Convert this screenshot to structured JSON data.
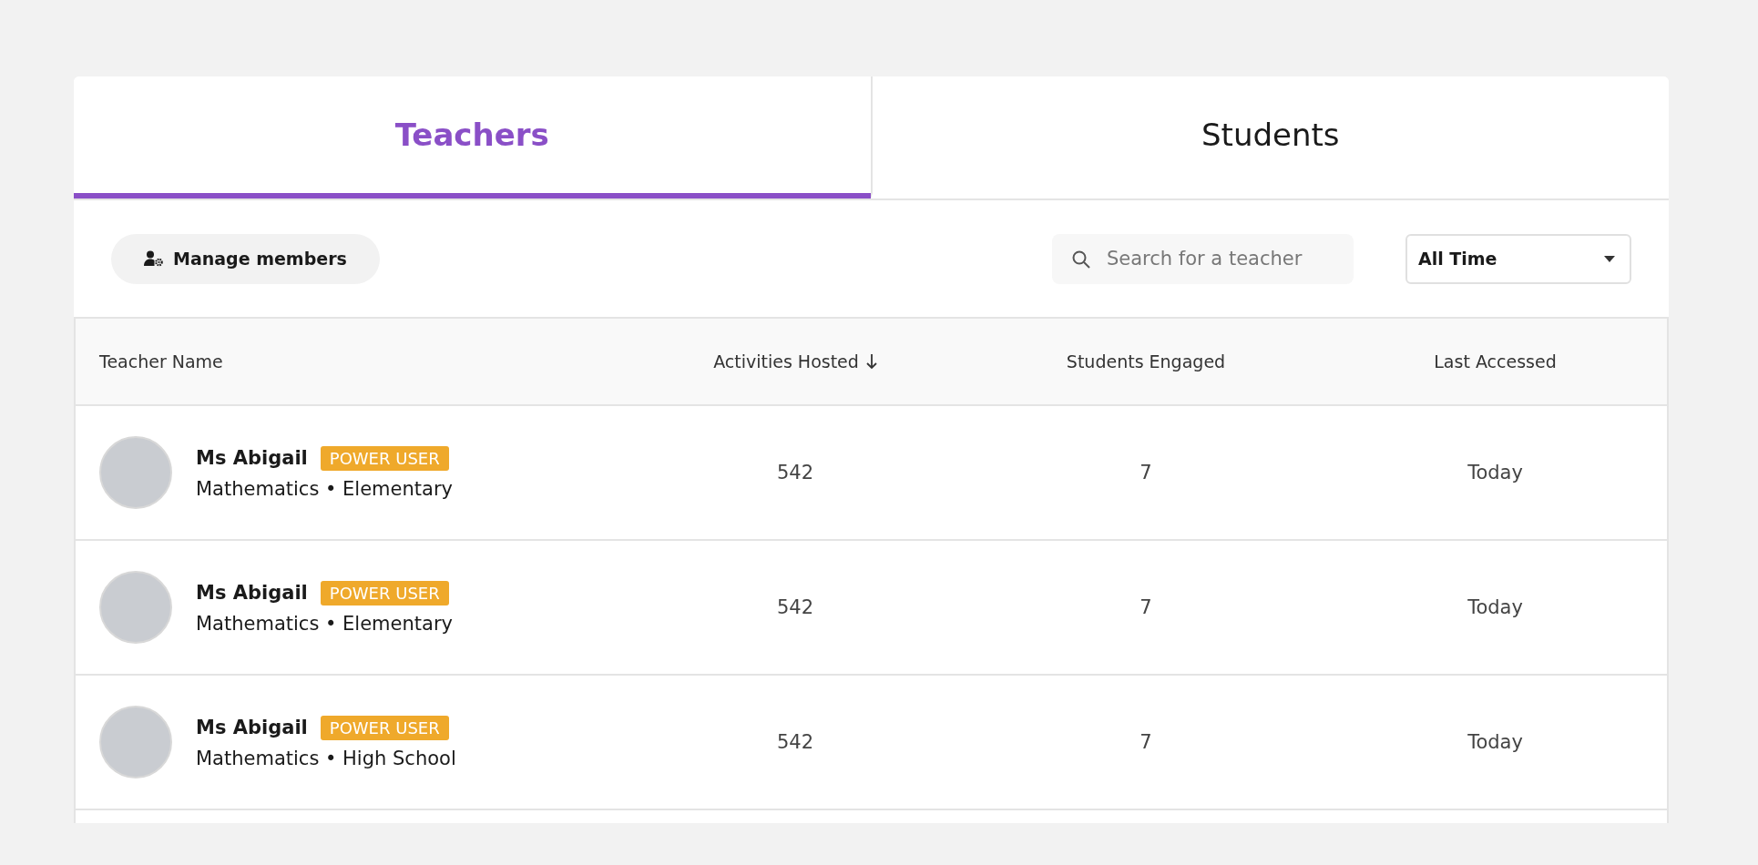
{
  "tabs": [
    {
      "label": "Teachers",
      "selected": true
    },
    {
      "label": "Students",
      "selected": false
    }
  ],
  "toolbar": {
    "manage_button": "Manage members",
    "search": {
      "placeholder": "Search for a teacher"
    },
    "period_dropdown": {
      "value": "All Time"
    }
  },
  "table": {
    "columns": [
      {
        "label": "Teacher Name",
        "sorted": false
      },
      {
        "label": "Activities Hosted",
        "sorted": true
      },
      {
        "label": "Students Engaged",
        "sorted": false
      },
      {
        "label": "Last Accessed",
        "sorted": false
      }
    ],
    "rows": [
      {
        "name": "Ms Abigail",
        "badge": "POWER USER",
        "subtitle": "Mathematics • Elementary",
        "activities_hosted": "542",
        "students_engaged": "7",
        "last_accessed": "Today"
      },
      {
        "name": "Ms Abigail",
        "badge": "POWER USER",
        "subtitle": "Mathematics • Elementary",
        "activities_hosted": "542",
        "students_engaged": "7",
        "last_accessed": "Today"
      },
      {
        "name": "Ms Abigail",
        "badge": "POWER USER",
        "subtitle": "Mathematics • High School",
        "activities_hosted": "542",
        "students_engaged": "7",
        "last_accessed": "Today"
      }
    ]
  }
}
